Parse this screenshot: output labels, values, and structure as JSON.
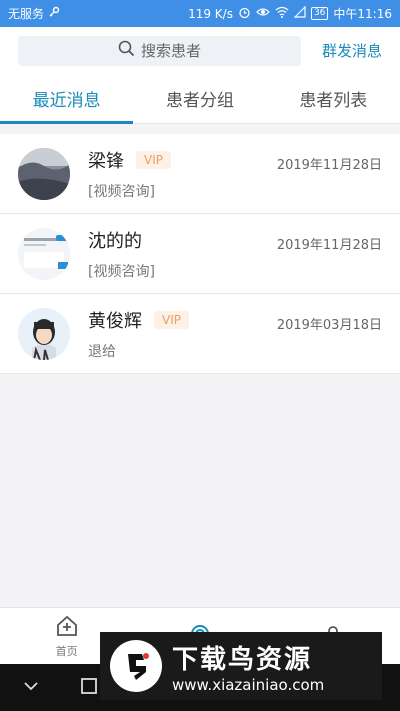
{
  "status_bar": {
    "carrier": "无服务",
    "speed": "119 K/s",
    "battery": "36",
    "time": "中午11:16"
  },
  "header": {
    "search_placeholder": "搜索患者",
    "broadcast_label": "群发消息"
  },
  "tabs": [
    {
      "label": "最近消息",
      "active": true
    },
    {
      "label": "患者分组",
      "active": false
    },
    {
      "label": "患者列表",
      "active": false
    }
  ],
  "messages": [
    {
      "name": "梁锋",
      "vip": "VIP",
      "date": "2019年11月28日",
      "preview": "[视频咨询]"
    },
    {
      "name": "沈的的",
      "vip": "",
      "date": "2019年11月28日",
      "preview": "[视频咨询]"
    },
    {
      "name": "黄俊辉",
      "vip": "VIP",
      "date": "2019年03月18日",
      "preview": "退给"
    }
  ],
  "bottom_nav": [
    {
      "label": "首页",
      "icon": "home-plus-icon"
    },
    {
      "label": "",
      "icon": "message-icon"
    },
    {
      "label": "",
      "icon": "user-icon"
    }
  ],
  "watermark": {
    "title": "下载鸟资源",
    "url": "www.xiazainiao.com"
  },
  "colors": {
    "status_bar": "#3f8fe6",
    "accent": "#1a8bb8",
    "vip_text": "#e6a06a"
  }
}
